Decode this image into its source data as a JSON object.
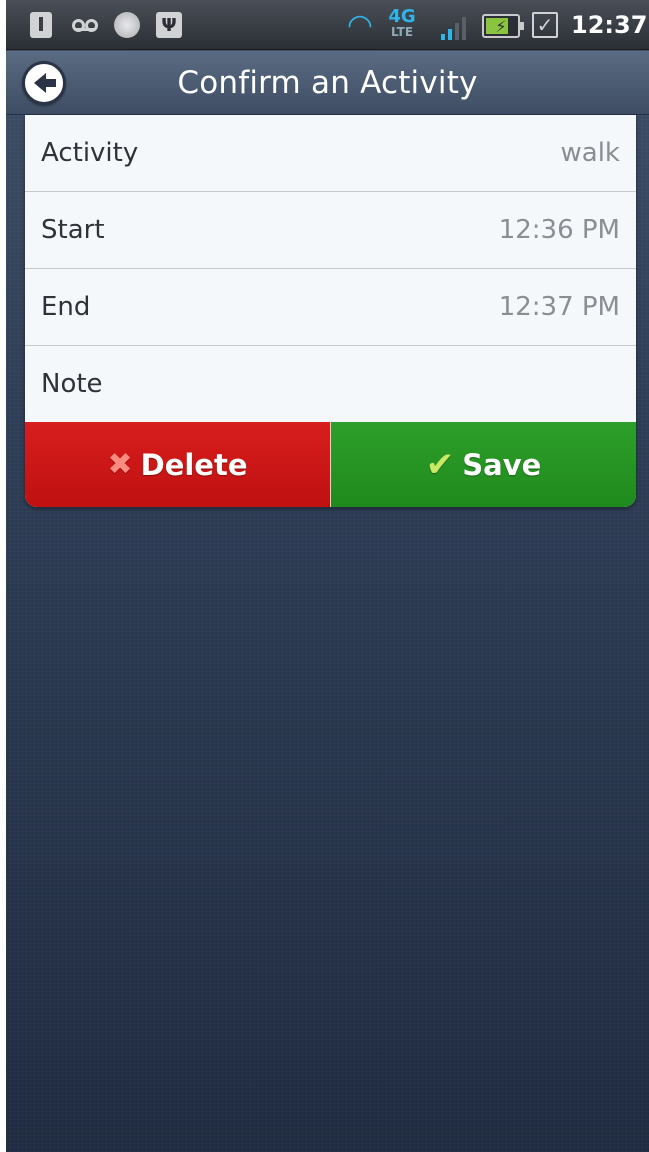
{
  "status_bar": {
    "time": "12:37",
    "network": "4G",
    "network_sub": "LTE",
    "icons": [
      "download-icon",
      "voicemail-icon",
      "notification-dot-icon",
      "usb-icon",
      "wifi-icon",
      "4g-lte-icon",
      "signal-icon",
      "battery-charging-icon",
      "checkbox-icon"
    ]
  },
  "header": {
    "title": "Confirm an Activity",
    "back_icon": "back-arrow-icon"
  },
  "form": {
    "rows": [
      {
        "label": "Activity",
        "value": "walk"
      },
      {
        "label": "Start",
        "value": "12:36 PM"
      },
      {
        "label": "End",
        "value": "12:37 PM"
      },
      {
        "label": "Note",
        "value": ""
      }
    ]
  },
  "actions": {
    "delete_label": "Delete",
    "save_label": "Save",
    "delete_color": "#c91515",
    "save_color": "#27931f"
  }
}
